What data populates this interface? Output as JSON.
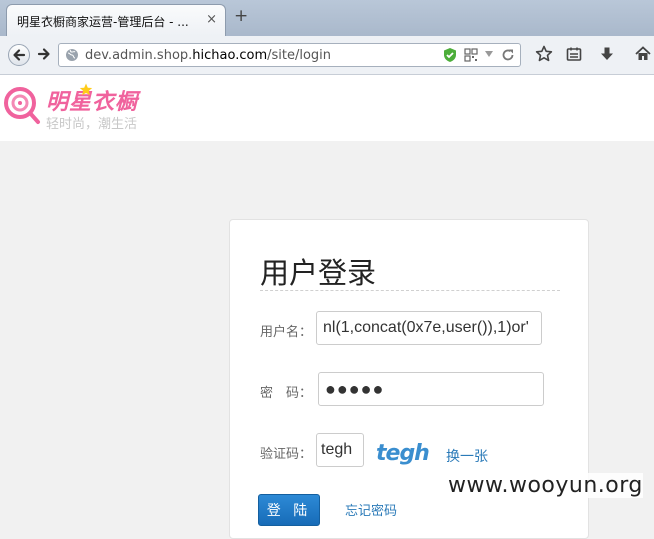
{
  "browser": {
    "tab_title": "明星衣橱商家运营-管理后台 - ...",
    "tab_close": "×",
    "new_tab": "+",
    "url_host_prefix": "dev.admin.shop.",
    "url_domain": "hichao.com",
    "url_path": "/site/login"
  },
  "header": {
    "logo_title": "明星衣橱",
    "logo_slogan": "轻时尚，潮生活",
    "brand_color": "#f0629d"
  },
  "login": {
    "title": "用户登录",
    "username_label": "用户名：",
    "username_value": "nl(1,concat(0x7e,user()),1)or'",
    "password_label": "密　码：",
    "password_value": "●●●●●",
    "captcha_label": "验证码：",
    "captcha_value": "tegh",
    "captcha_image_text": "tegh",
    "refresh_captcha": "换一张",
    "login_button": "登 陆",
    "forgot_password": "忘记密码",
    "accent_color": "#176bb7"
  },
  "watermark": "www.wooyun.org"
}
